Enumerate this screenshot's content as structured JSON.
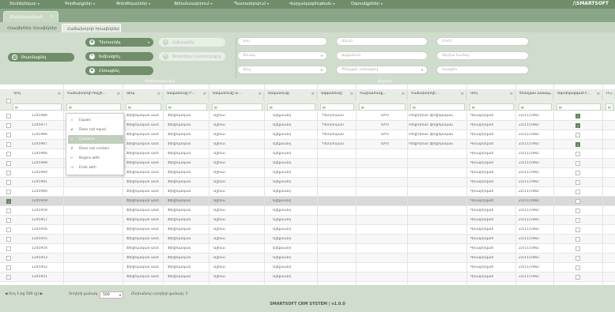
{
  "menu": {
    "items": [
      "Տեսներեկար",
      "Գործարքներ",
      "Փոխճեկարներ",
      "Ֆինանսավորում",
      "Պատարկովում",
      "Վարչակազմութեան",
      "Օգտանքիներ"
    ],
    "brand": "/\\SMARTSOFT"
  },
  "tabs": {
    "main": "Տեսննեղունեան",
    "close": "×"
  },
  "subtabs": [
    "Հրավերներ Հրավեկներ",
    "Հաճախորդի հրավեկներ"
  ],
  "toolbar": {
    "refresh": "Թարմացնել",
    "view": "Դիտարկել",
    "edit": "Խմբագրել",
    "delete": "Հեռացնել",
    "add": "Ավելացնել",
    "change": "Փոփոխել հաղորդագրը",
    "group_actions": "Գործողություններ",
    "group_filters": "Ֆիլտրեր"
  },
  "filters": {
    "col1": [
      "Կոդ",
      "Տեսակ",
      "Տիպ"
    ],
    "col2": [
      "Անուն",
      "Ազգանուն",
      "Ծննդյան ամսաթիվ"
    ],
    "col3": [
      "ՀՎՀՀ",
      "Սերիա համար",
      "Հասցեն"
    ]
  },
  "grid": {
    "columns": [
      "Կոդ",
      "Հաճախորդի հաշի...",
      "Տիպ",
      "Անվանումը Ի...",
      "Անվանումը Ա...",
      "Անվանումը",
      "Ազգանունը",
      "Հայրանունը...",
      "Հաճախորդի...",
      "Կոդ",
      "Ծննդյան ամսա...",
      "Ակտիվացված է...",
      "Ռ"
    ],
    "filter_icon": "≡",
    "filter_cell_icon": "▤",
    "rows": [
      {
        "code": "1245986",
        "type": "Ֆիզիկական անձ",
        "tin": "Ֆիզիկական",
        "name1": "Ալինա",
        "name2": "Ալեքսանդ",
        "name3": "Պետրոսյան",
        "sub": "ԱԻՄ",
        "sub2": "Ռեզիդենտ ֆիզիկական",
        "code2": "Գրավորված",
        "date": "22/11/1982",
        "active": true
      },
      {
        "code": "1245977",
        "type": "Ֆիզիկական անձ",
        "tin": "Ֆիզիկական",
        "name1": "Ալինա",
        "name2": "Ալեքսանդ",
        "name3": "Պետրոսյան",
        "sub": "ԱԻՄ",
        "sub2": "Ռեզիդենտ ֆիզիկական",
        "code2": "Գրավորված",
        "date": "22/11/1982",
        "active": true
      },
      {
        "code": "1245966",
        "type": "Ֆիզիկական անձ",
        "tin": "Ֆիզիկական",
        "name1": "Ալինա",
        "name2": "Ալեքսանդ",
        "name3": "Պետրոսյան",
        "sub": "ԱԻՄ",
        "sub2": "Ռեզիդենտ ֆիզիկական",
        "code2": "Գրավորված",
        "date": "22/11/1982",
        "active": false
      },
      {
        "code": "1245967",
        "type": "Ֆիզիկական անձ",
        "tin": "Ֆիզիկական",
        "name1": "Ալինա",
        "name2": "Ալեքսանդ",
        "name3": "Պետրոսյան",
        "sub": "ԱԻՄ",
        "sub2": "Ռեզիդենտ ֆիզիկական",
        "code2": "Գրավորված",
        "date": "22/11/1982",
        "active": true
      },
      {
        "code": "1245966",
        "type": "Ֆիզիկական անձ",
        "tin": "Ֆիզիկական",
        "name1": "Ալինա",
        "name2": "Ալեքսանդ",
        "name3": "",
        "sub": "",
        "sub2": "",
        "code2": "Գրավորված",
        "date": "22/11/1982",
        "active": false
      },
      {
        "code": "1245968",
        "type": "Ֆիզիկական անձ",
        "tin": "Ֆիզիկական",
        "name1": "Ալինա",
        "name2": "Ալեքսանդ",
        "name3": "",
        "sub": "",
        "sub2": "",
        "code2": "Գրավորված",
        "date": "22/11/1982",
        "active": false
      },
      {
        "code": "1245964",
        "type": "Ֆիզիկական անձ",
        "tin": "Ֆիզիկական",
        "name1": "Ալինա",
        "name2": "Ալեքսանդ",
        "name3": "",
        "sub": "",
        "sub2": "",
        "code2": "Գրավորված",
        "date": "22/11/1982",
        "active": false
      },
      {
        "code": "1245961",
        "type": "Ֆիզիկական անձ",
        "tin": "Ֆիզիկական",
        "name1": "Ալինա",
        "name2": "Ալեքսանդ",
        "name3": "",
        "sub": "",
        "sub2": "",
        "code2": "Գրավորված",
        "date": "22/11/1982",
        "active": false
      },
      {
        "code": "1245960",
        "type": "Ֆիզիկական անձ",
        "tin": "Ֆիզիկական",
        "name1": "Ալինա",
        "name2": "Ալեքսանդ",
        "name3": "",
        "sub": "",
        "sub2": "",
        "code2": "Գրավորված",
        "date": "22/11/1982",
        "active": false
      },
      {
        "code": "1245959",
        "type": "Ֆիզիկական անձ",
        "tin": "Ֆիզիկական",
        "name1": "Ալինա",
        "name2": "Ալեքսանդ",
        "name3": "",
        "sub": "",
        "sub2": "",
        "code2": "Գրավորված",
        "date": "22/11/1982",
        "active": false
      },
      {
        "code": "1245958",
        "type": "Ֆիզիկական անձ",
        "tin": "Ֆիզիկական",
        "name1": "Ալինա",
        "name2": "Ալեքսանդ",
        "name3": "",
        "sub": "",
        "sub2": "",
        "code2": "Գրավորված",
        "date": "22/11/1982",
        "active": false
      },
      {
        "code": "1245957",
        "type": "Ֆիզիկական անձ",
        "tin": "Ֆիզիկական",
        "name1": "Ալինա",
        "name2": "Ալեքսանդ",
        "name3": "",
        "sub": "",
        "sub2": "",
        "code2": "Գրավորված",
        "date": "22/11/1982",
        "active": false
      },
      {
        "code": "1245956",
        "type": "Ֆիզիկական անձ",
        "tin": "Ֆիզիկական",
        "name1": "Ալինա",
        "name2": "Ալեքսանդ",
        "name3": "",
        "sub": "",
        "sub2": "",
        "code2": "Գրավորված",
        "date": "22/11/1982",
        "active": false
      },
      {
        "code": "1245955",
        "type": "Ֆիզիկական անձ",
        "tin": "Ֆիզիկական",
        "name1": "Ալինա",
        "name2": "Ալեքսանդ",
        "name3": "",
        "sub": "",
        "sub2": "",
        "code2": "Գրավորված",
        "date": "22/11/1982",
        "active": false
      },
      {
        "code": "1245954",
        "type": "Ֆիզիկական անձ",
        "tin": "Ֆիզիկական",
        "name1": "Ալինա",
        "name2": "Ալեքսանդ",
        "name3": "",
        "sub": "",
        "sub2": "",
        "code2": "Գրավորված",
        "date": "22/11/1982",
        "active": false
      },
      {
        "code": "1245953",
        "type": "Ֆիզիկական անձ",
        "tin": "Ֆիզիկական",
        "name1": "Ալինա",
        "name2": "Ալեքսանդ",
        "name3": "",
        "sub": "",
        "sub2": "",
        "code2": "Գրավորված",
        "date": "22/11/1982",
        "active": false
      },
      {
        "code": "1245952",
        "type": "Ֆիզիկական անձ",
        "tin": "Ֆիզիկական",
        "name1": "Ալինա",
        "name2": "Ալեքսանդ",
        "name3": "",
        "sub": "",
        "sub2": "",
        "code2": "Գրավորված",
        "date": "22/11/1982",
        "active": false
      },
      {
        "code": "1245951",
        "type": "Ֆիզիկական անձ",
        "tin": "Ֆիզիկական",
        "name1": "Ալինա",
        "name2": "Ալեքսանդ",
        "name3": "",
        "sub": "",
        "sub2": "",
        "code2": "Գրավորված",
        "date": "22/11/1982",
        "active": false
      }
    ],
    "selected_row": 9
  },
  "filter_menu": {
    "items": [
      "Equals",
      "Does not equal",
      "Contains",
      "Does not contain",
      "Begins with",
      "Ends with"
    ],
    "icons": [
      "=",
      "≠",
      "⊂",
      "⊄",
      "⊢",
      "⊣"
    ],
    "active": 2
  },
  "footer": {
    "pager_info": "Տող 1-ից 500 (ը)",
    "page_size_label": "Տողերի քանակ",
    "page_size": "500",
    "total_label": "Ընդհանուր տողերի քանակ: 1",
    "copyright": "SMARTSOFT CRM SYSTEM | v1.0.0"
  },
  "colors": {
    "accent": "#6f8e69",
    "header": "#6f8d6a",
    "panel": "#d0dccc"
  }
}
